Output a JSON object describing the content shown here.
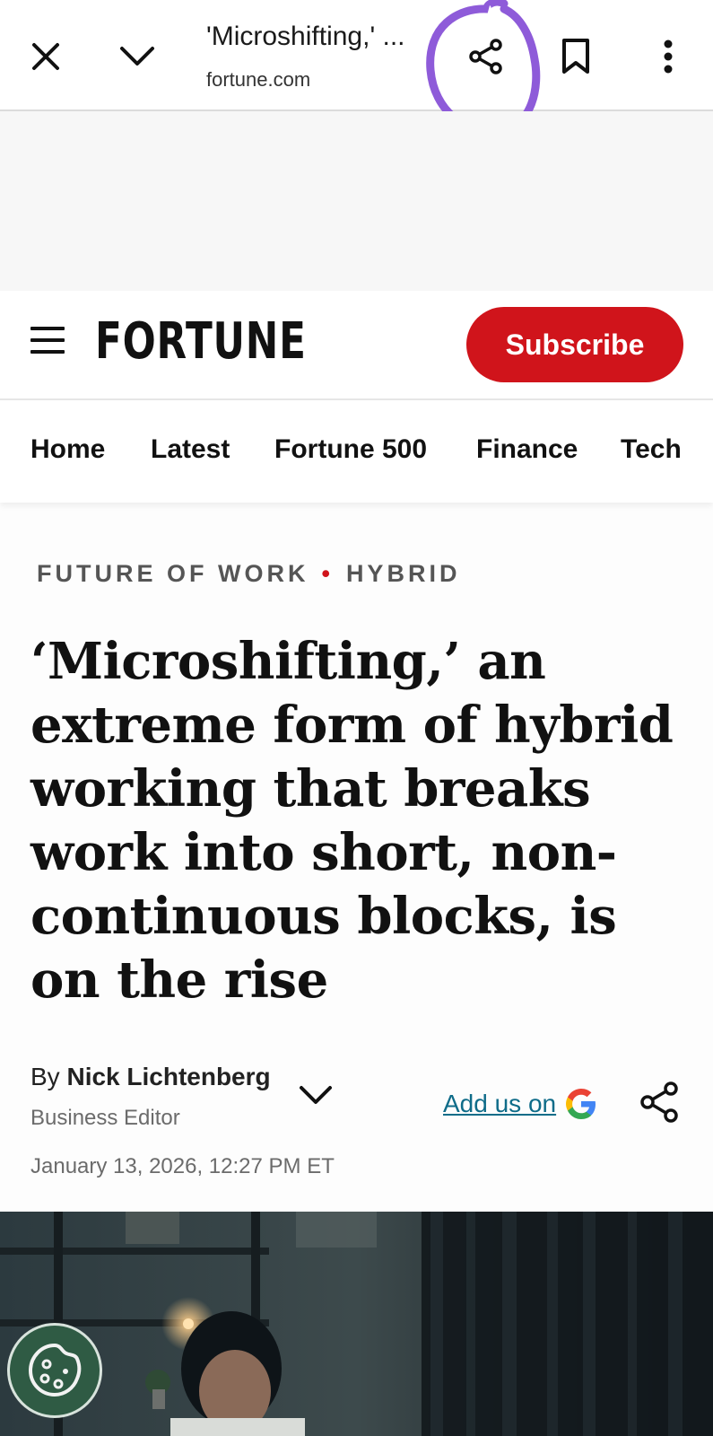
{
  "browser": {
    "tab_title": "'Microshifting,' ...",
    "domain": "fortune.com",
    "icons": [
      "close-icon",
      "chevron-down-icon",
      "share-icon",
      "bookmark-icon",
      "more-vert-icon"
    ],
    "annotation_color": "#8e5bd9"
  },
  "site": {
    "logo": "FORTUNE",
    "subscribe_label": "Subscribe",
    "brand_red": "#d0141b"
  },
  "nav": {
    "items": [
      "Home",
      "Latest",
      "Fortune 500",
      "Finance",
      "Tech"
    ]
  },
  "article": {
    "category": "FUTURE OF WORK",
    "subcategory": "HYBRID",
    "headline": "‘Microshifting,’ an extreme form of hybrid working that breaks work into short, non-continuous blocks, is on the rise",
    "byline_prefix": "By",
    "author": "Nick Lichtenberg",
    "author_title": "Business Editor",
    "add_us_label": "Add us on",
    "date": "January 13, 2026, 12:27 PM ET",
    "link_color": "#0f6c89"
  }
}
